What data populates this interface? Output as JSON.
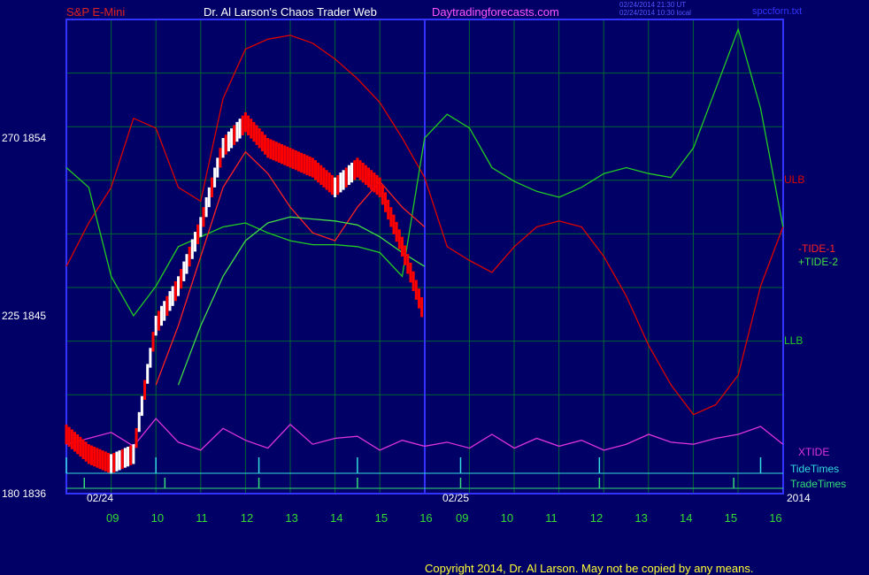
{
  "header": {
    "symbol": "S&P E-Mini",
    "author": "Dr. Al Larson's Chaos Trader Web",
    "site": "Daytradingforecasts.com",
    "stamp1": "02/24/2014 21:30 UT",
    "stamp2": "02/24/2014 10:30 local",
    "file": "spccforn.txt"
  },
  "footer": {
    "copyright": "Copyright 2014, Dr. Al Larson. May not be copied by any means."
  },
  "y_axis_labels": [
    {
      "text": "270  1854",
      "price": 1854
    },
    {
      "text": "225  1845",
      "price": 1845
    },
    {
      "text": "180  1836",
      "price": 1836
    }
  ],
  "x_axis": {
    "hour_ticks": [
      "09",
      "10",
      "11",
      "12",
      "13",
      "14",
      "15",
      "16",
      "09",
      "10",
      "11",
      "12",
      "13",
      "14",
      "15",
      "16"
    ],
    "date_labels": [
      "02/24",
      "02/25"
    ],
    "year": "2014"
  },
  "colors": {
    "background": "#000066",
    "frame": "#3333ff",
    "grid": "#006633",
    "ulb": "#dd0000",
    "llb": "#22cc22",
    "tide1": "#ff2222",
    "tide2": "#44dd44",
    "xtide": "#dd33dd",
    "tidetimes": "#33dddd",
    "tradetimes": "#33dd77",
    "fast_avg": "#ffcc00",
    "mid_avg": "#33ccff",
    "slow_avg": "#22cc22"
  },
  "chart_data": {
    "type": "line",
    "title": "S&P E-Mini",
    "ylim": [
      1836,
      1860
    ],
    "series_labels": [
      "ULB",
      "-TIDE-1",
      "+TIDE-2",
      "LLB",
      "XTIDE",
      "TideTimes",
      "TradeTimes"
    ],
    "x_hours": [
      8.0,
      8.5,
      9.0,
      9.5,
      10.0,
      10.5,
      11.0,
      11.5,
      12.0,
      12.5,
      13.0,
      13.5,
      14.0,
      14.5,
      15.0,
      15.5,
      16.0,
      16.5,
      17.0,
      17.5,
      18.0,
      18.5,
      19.0,
      19.5,
      20.0,
      20.5,
      21.0,
      21.5,
      22.0,
      22.5,
      23.0,
      23.5,
      24.0
    ],
    "series": [
      {
        "name": "ULB",
        "values": [
          1847.5,
          1849.7,
          1851.5,
          1855.0,
          1854.5,
          1851.5,
          1850.8,
          1856.0,
          1858.5,
          1859.0,
          1859.2,
          1858.8,
          1858.0,
          1857.0,
          1855.8,
          1854.0,
          1852.0,
          1848.5,
          1847.8,
          1847.2,
          1848.5,
          1849.5,
          1849.8,
          1849.5,
          1848.0,
          1846.0,
          1843.5,
          1841.5,
          1840.0,
          1840.5,
          1842.0,
          1846.5,
          1849.5
        ]
      },
      {
        "name": "LLB",
        "values": [
          1852.5,
          1851.5,
          1847.0,
          1845.0,
          1846.5,
          1848.5,
          1849.0,
          1849.5,
          1849.7,
          1849.2,
          1848.8,
          1848.6,
          1848.6,
          1848.5,
          1848.2,
          1847.0,
          1854.0,
          1855.2,
          1854.5,
          1852.5,
          1851.8,
          1851.3,
          1851.0,
          1851.5,
          1852.2,
          1852.5,
          1852.2,
          1852.0,
          1853.5,
          1856.5,
          1859.5,
          1855.5,
          1849.5
        ]
      },
      {
        "name": "-TIDE-1",
        "values": [
          null,
          null,
          null,
          null,
          1841.5,
          1844.5,
          1848.0,
          1851.5,
          1853.3,
          1852.2,
          1850.5,
          1849.2,
          1848.8,
          1850.5,
          1851.8,
          1850.5,
          1849.5
        ]
      },
      {
        "name": "+TIDE-2",
        "values": [
          null,
          null,
          null,
          null,
          null,
          1841.5,
          1844.5,
          1847.0,
          1848.8,
          1849.7,
          1850.0,
          1849.9,
          1849.8,
          1849.6,
          1849.0,
          1848.2,
          1847.5
        ]
      },
      {
        "name": "XTIDE",
        "values": [
          1838.5,
          1838.8,
          1839.1,
          1838.4,
          1839.8,
          1838.6,
          1838.2,
          1839.3,
          1838.7,
          1838.3,
          1839.5,
          1838.5,
          1838.8,
          1838.9,
          1838.2,
          1838.7,
          1838.4,
          1838.6,
          1838.3,
          1839.0,
          1838.3,
          1838.8,
          1838.4,
          1838.7,
          1838.2,
          1838.5,
          1839.0,
          1838.6,
          1838.5,
          1838.8,
          1839.0,
          1839.4,
          1838.5
        ]
      }
    ],
    "price_series": {
      "name": "S&P E-Mini",
      "x": [
        8.0,
        8.5,
        9.0,
        9.5,
        10.0,
        10.5,
        11.0,
        11.5,
        12.0,
        12.5,
        13.0,
        13.5,
        14.0,
        14.5,
        15.0,
        15.5,
        16.0
      ],
      "values": [
        1839.0,
        1838.0,
        1837.5,
        1838.0,
        1844.5,
        1846.5,
        1849.5,
        1853.5,
        1854.8,
        1853.5,
        1853.0,
        1852.5,
        1851.5,
        1852.5,
        1851.5,
        1848.5,
        1845.0
      ],
      "color": "#ffffff"
    },
    "tide_times_hours": [
      8.0,
      10.0,
      12.3,
      14.5,
      16.8,
      19.9,
      23.5
    ],
    "trade_times_hours": [
      8.4,
      10.2,
      12.3,
      14.5,
      16.8,
      19.9,
      22.9
    ]
  }
}
